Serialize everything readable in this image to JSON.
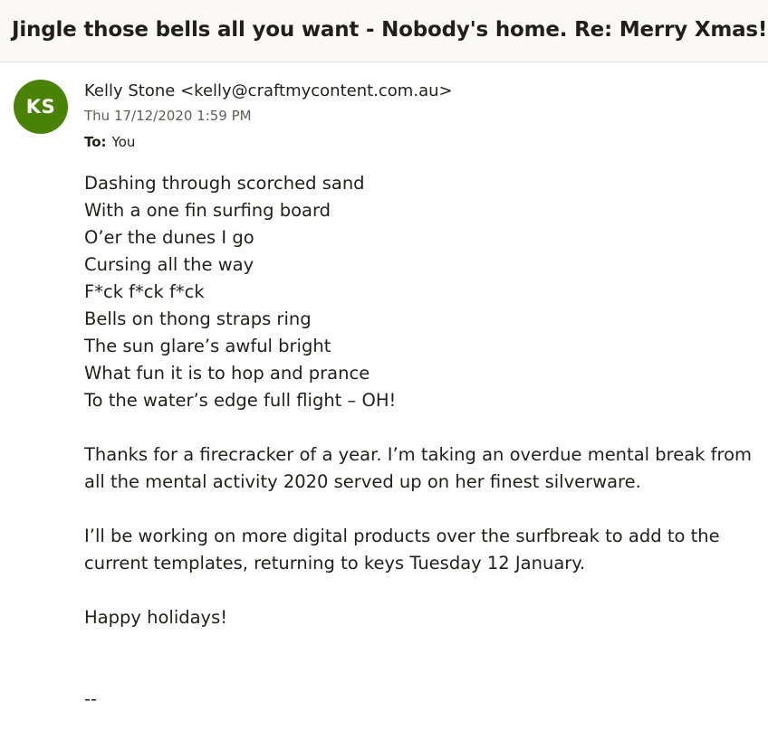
{
  "email": {
    "subject": "Jingle those bells all you want - Nobody's home. Re: Merry Xmas!",
    "avatar_initials": "KS",
    "avatar_color": "#498205",
    "sender_name": "Kelly Stone",
    "sender_email": "<kelly@craftmycontent.com.au>",
    "timestamp": "Thu 17/12/2020 1:59 PM",
    "to_label": "To:",
    "to_value": "You",
    "poem": [
      "Dashing through scorched sand",
      "With a one fin surfing board",
      "O’er the dunes I go",
      "Cursing all the way",
      "F*ck f*ck f*ck",
      "Bells on thong straps ring",
      "The sun glare’s awful bright",
      "What fun it is to hop and prance",
      "To the water’s edge full flight – OH!"
    ],
    "paragraph1": "Thanks for a firecracker of a year. I’m taking an overdue mental break from all the mental activity 2020 served up on her finest silverware.",
    "paragraph2": "I’ll be working on more digital products over the surfbreak to add to the current templates, returning to keys Tuesday 12 January.",
    "sign_off": "Happy holidays!",
    "signature_separator": "--"
  }
}
